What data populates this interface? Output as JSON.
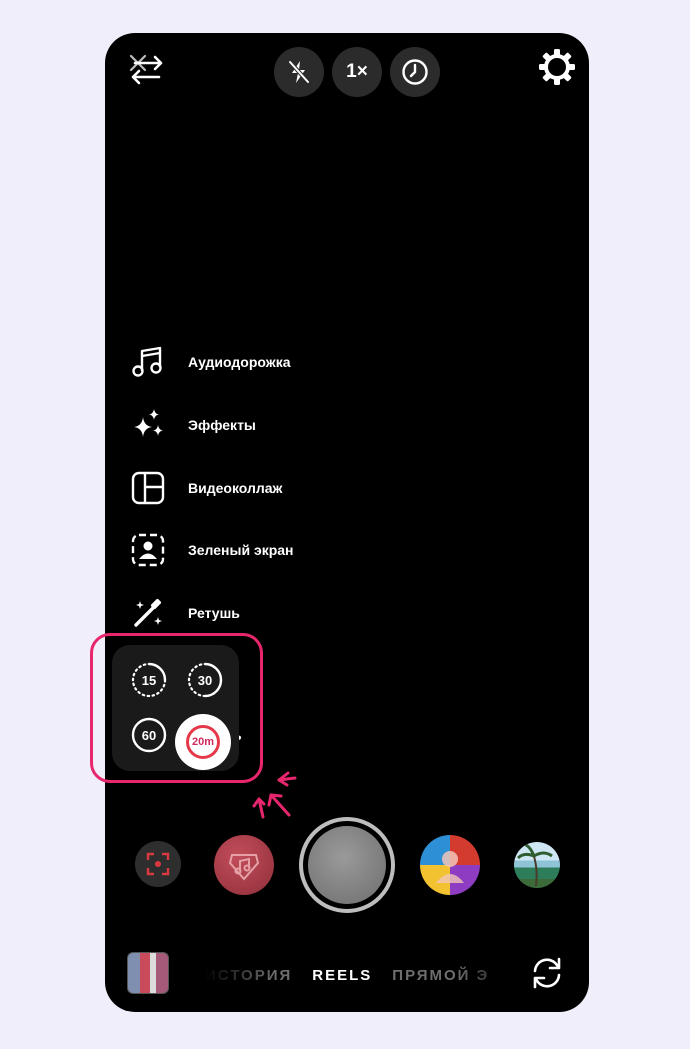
{
  "top_bar": {
    "zoom_label": "1×"
  },
  "side_menu": [
    {
      "id": "audio",
      "label": "Аудиодорожка",
      "icon": "music-note-icon"
    },
    {
      "id": "effects",
      "label": "Эффекты",
      "icon": "sparkles-icon"
    },
    {
      "id": "collage",
      "label": "Видеоколлаж",
      "icon": "layout-icon"
    },
    {
      "id": "green-screen",
      "label": "Зеленый экран",
      "icon": "green-screen-icon"
    },
    {
      "id": "retouch",
      "label": "Ретушь",
      "icon": "magic-wand-icon"
    },
    {
      "id": "hidden",
      "label": "ь"
    }
  ],
  "duration_picker": {
    "options": [
      "15",
      "30",
      "60"
    ],
    "selected": "20m"
  },
  "modes": [
    "ИСТОРИЯ",
    "REELS",
    "ПРЯМОЙ Э"
  ],
  "active_mode": "REELS",
  "colors": {
    "highlight": "#e8266e",
    "background": "#f1eefb",
    "selected_ring": "#e5394a"
  }
}
